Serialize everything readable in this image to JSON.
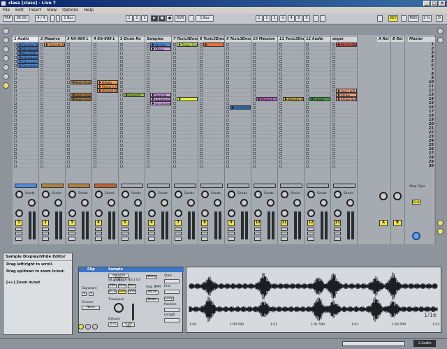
{
  "window": {
    "title": "class [class] - Live 7",
    "min": "_",
    "max": "□",
    "close": "×"
  },
  "menu": [
    "File",
    "Edit",
    "Insert",
    "View",
    "Options",
    "Help"
  ],
  "control_bar": {
    "tap": "TAP",
    "tempo": "95.00",
    "signature": "4 / 4",
    "quantize": "1 Bar",
    "position": [
      "1",
      "1",
      "1"
    ],
    "ovr": "OVR",
    "loop_start": [
      "1",
      "1",
      "1"
    ],
    "loop_length": [
      "4",
      "0",
      "0"
    ],
    "key": "KEY",
    "midi": "MIDI",
    "cpu": "2 %",
    "in_out": "D"
  },
  "tracks": [
    {
      "name": "1 Audio",
      "color": "#4a8de0",
      "clips": [
        {
          "row": 0,
          "name": "Monday Bas",
          "color": "#4a8de0"
        },
        {
          "row": 1,
          "name": "Wednesdays",
          "color": "#4a8de0"
        },
        {
          "row": 2,
          "name": "Key trick",
          "color": "#4a8de0"
        },
        {
          "row": 3,
          "name": "Introducing",
          "color": "#4a8de0"
        },
        {
          "row": 4,
          "name": "Intro are you",
          "color": "#4a8de0"
        },
        {
          "row": 5,
          "name": "Bangkoks Ec",
          "color": "#4a8de0"
        }
      ]
    },
    {
      "name": "2 Massive",
      "color": "#b08040",
      "clips": [
        {
          "row": 0,
          "name": "Smooth Bas",
          "color": "#f0a050"
        }
      ]
    },
    {
      "name": "3 Kit-909 L",
      "color": "#b08040",
      "clips": [
        {
          "row": 9,
          "name": "Bass Groov",
          "color": "#b08040"
        },
        {
          "row": 12,
          "name": "Bass Groov",
          "color": "#b08040"
        },
        {
          "row": 13,
          "name": "Bass Groov",
          "color": "#b08040"
        }
      ]
    },
    {
      "name": "4 Kit-808 L",
      "color": "#c06030",
      "clips": [
        {
          "row": 9,
          "name": "Hihats",
          "color": "#f0a050"
        },
        {
          "row": 10,
          "name": "Clang n Hihi",
          "color": "#f0a050"
        },
        {
          "row": 11,
          "name": "(Digital Dutch",
          "color": "#f0a050"
        }
      ]
    },
    {
      "name": "5 Drum Ra",
      "color": "#a0c040",
      "clips": [
        {
          "row": 12,
          "name": "Remoth",
          "color": "#a0c040"
        }
      ]
    },
    {
      "name": "Samples",
      "color": "#d0a0e0",
      "clips": [
        {
          "row": 0,
          "name": "Strings",
          "color": "#4a8de0"
        },
        {
          "row": 1,
          "name": "Stage",
          "color": "#d0a0e0"
        },
        {
          "row": 12,
          "name": "Swords",
          "color": "#d0a0e0"
        },
        {
          "row": 13,
          "name": "Laughing",
          "color": "#d0a0e0"
        },
        {
          "row": 14,
          "name": "Scratches",
          "color": "#d0a0e0"
        }
      ]
    },
    {
      "name": "7 Toxic3Dmo",
      "color": "#d8e860",
      "clips": [
        {
          "row": 0,
          "name": "Trippy Synth",
          "color": "#c8e040"
        },
        {
          "row": 13,
          "name": "",
          "color": "#e8f040"
        }
      ]
    },
    {
      "name": "8 Toxic3Dmo",
      "color": "#f07030",
      "clips": [
        {
          "row": 0,
          "name": "",
          "color": "#f07030"
        }
      ]
    },
    {
      "name": "9 Toxic3Dmo",
      "color": "#3060a0",
      "clips": [
        {
          "row": 15,
          "name": "",
          "color": "#3060a0"
        }
      ]
    },
    {
      "name": "10 Massive",
      "color": "#c060c0",
      "clips": [
        {
          "row": 13,
          "name": "Phase 4",
          "color": "#c060c0"
        }
      ]
    },
    {
      "name": "11 Toxic3Dm",
      "color": "#d0b040",
      "clips": [
        {
          "row": 13,
          "name": "Melodic Synth",
          "color": "#d0b040"
        }
      ]
    },
    {
      "name": "12 Audio",
      "color": "#40a040",
      "clips": [
        {
          "row": 13,
          "name": "Larger",
          "color": "#40a040"
        }
      ]
    },
    {
      "name": "anger",
      "color": "#e05040",
      "clips": [
        {
          "row": 0,
          "name": "My AntiBea",
          "color": "#e05040"
        },
        {
          "row": 11,
          "name": "and I will",
          "color": "#f0a080"
        },
        {
          "row": 12,
          "name": "Strike",
          "color": "#f0a080"
        },
        {
          "row": 13,
          "name": "Strike Scen",
          "color": "#f0a080"
        }
      ]
    }
  ],
  "returns": [
    {
      "name": "A Ret",
      "num": "A"
    },
    {
      "name": "B Ret",
      "num": "B"
    }
  ],
  "master": {
    "name": "Master",
    "stop": "Stop Clips"
  },
  "scenes": [
    "1",
    "2",
    "3",
    "4",
    "5",
    "6",
    "7",
    "8",
    "9",
    "10",
    "11",
    "12",
    "13",
    "14",
    "15",
    "16",
    "17",
    "18",
    "19",
    "20",
    "21",
    "22",
    "23",
    "24",
    "25",
    "26",
    "27",
    "28",
    "29",
    "30"
  ],
  "mixer_labels": {
    "sends": "Sends",
    "track_numbers": [
      "1",
      "2",
      "3",
      "4",
      "5",
      "6",
      "7",
      "8",
      "9",
      "10",
      "11",
      "12",
      "13"
    ],
    "post": "Post"
  },
  "info": {
    "title": "Sample Display/Wide Editor",
    "lines": [
      "Drag left/right to scroll.",
      "Drag up/down to zoom in/out.",
      "[+/-] Zoom in/out"
    ]
  },
  "clip": {
    "tab_clip": "Clip",
    "tab_sample": "Sample",
    "sample_name": "warping from scratch",
    "sample_info": "44.1 kHz 16 Bit 2 Ch",
    "buttons": [
      "Edit",
      "Save",
      "Rev.",
      "Hi-Q",
      "Fade",
      "RAM"
    ],
    "signature_label": "Signature",
    "sig_num": "4",
    "sig_den": "4",
    "groove_label": "Groove",
    "groove_val": "None",
    "warp": "Warp",
    "seg_bpm": "Seg. BPM",
    "seg_bpm_val": "98.00",
    "beats": "Beats",
    "transpose": "Transpose",
    "detune": "Detune",
    "detune_val": "0 ct",
    "vol_val": "0.00 dB",
    "start": "Start",
    "end": "End",
    "loop": "Loop",
    "position": "Position",
    "length": "Length",
    "timeline": [
      "1:00",
      "1:00:500",
      "1:01",
      "1:01:500",
      "1:02",
      "1:02:500",
      "1:03"
    ],
    "zoom": "1/16"
  },
  "status": {
    "right": "1-Audio"
  }
}
